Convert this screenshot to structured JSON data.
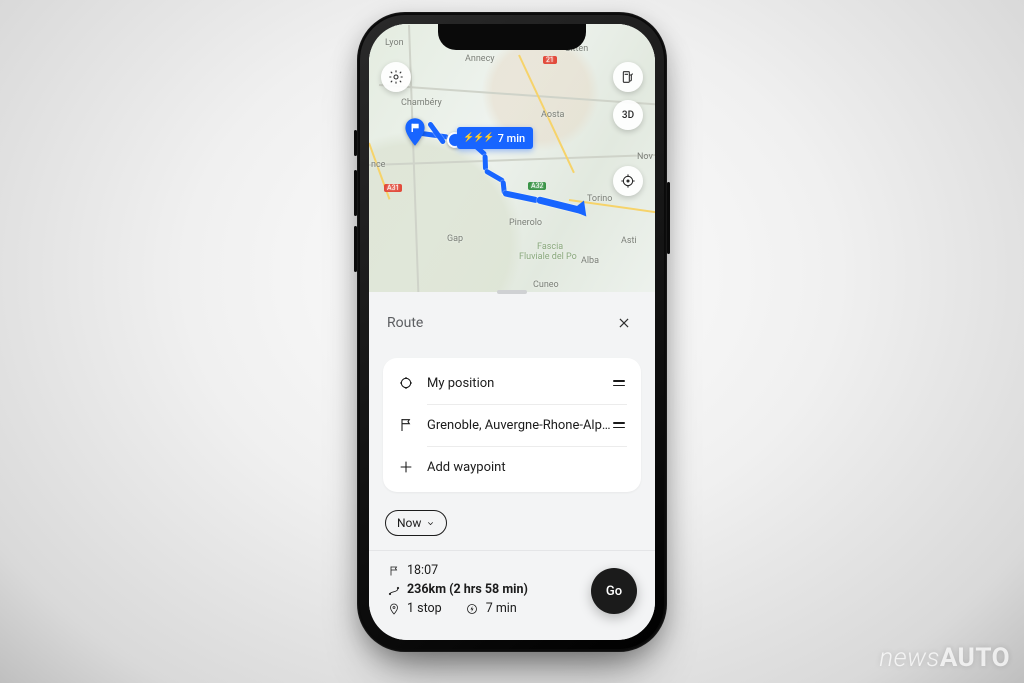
{
  "watermark": {
    "light": "news",
    "bold": "AUTO"
  },
  "map": {
    "cities": {
      "lyon": "Lyon",
      "annecy": "Annecy",
      "sitten": "Sitten",
      "chambery": "Chambéry",
      "aosta": "Aosta",
      "nov": "Nov",
      "torino": "Torino",
      "pinerolo": "Pinerolo",
      "asti": "Asti",
      "alba": "Alba",
      "cuneo": "Cuneo",
      "gap": "Gap",
      "nce": "nce",
      "fascia": "Fascia",
      "fluviale": "Fluviale del Po"
    },
    "highways": {
      "a31": "A31",
      "a32": "A32",
      "e21": "21"
    },
    "charge_badge": "7 min",
    "controls": {
      "view3d": "3D"
    }
  },
  "sheet": {
    "title": "Route",
    "origin": "My position",
    "destination": "Grenoble, Auvergne-Rhone-Alpe...",
    "add_waypoint": "Add waypoint",
    "depart": "Now"
  },
  "summary": {
    "arrival": "18:07",
    "distance": "236km (2 hrs 58 min)",
    "stops": "1 stop",
    "charge": "7 min",
    "go": "Go"
  }
}
